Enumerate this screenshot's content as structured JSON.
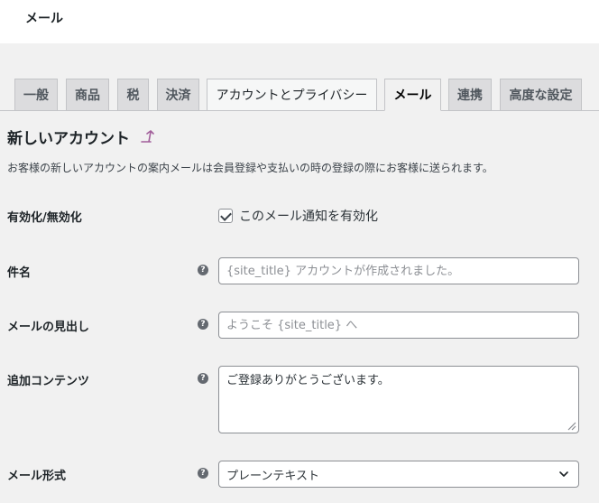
{
  "header": {
    "title": "メール"
  },
  "tabs": [
    {
      "label": "一般"
    },
    {
      "label": "商品"
    },
    {
      "label": "税"
    },
    {
      "label": "決済"
    },
    {
      "label": "アカウントとプライバシー"
    },
    {
      "label": "メール",
      "active": true
    },
    {
      "label": "連携"
    },
    {
      "label": "高度な設定"
    }
  ],
  "section": {
    "title": "新しいアカウント",
    "description": "お客様の新しいアカウントの案内メールは会員登録や支払いの時の登録の際にお客様に送られます。"
  },
  "form": {
    "enable": {
      "label": "有効化/無効化",
      "checkbox_label": "このメール通知を有効化",
      "checked": true
    },
    "subject": {
      "label": "件名",
      "placeholder": "{site_title} アカウントが作成されました。",
      "value": ""
    },
    "heading": {
      "label": "メールの見出し",
      "placeholder": "ようこそ {site_title} へ",
      "value": ""
    },
    "additional_content": {
      "label": "追加コンテンツ",
      "value": "ご登録ありがとうございます。"
    },
    "email_type": {
      "label": "メール形式",
      "selected": "プレーンテキスト"
    }
  },
  "icons": {
    "help": "question-circle-icon",
    "up": "up-arrow-icon",
    "select": "chevron-down-icon"
  },
  "colors": {
    "background": "#f1f1f1",
    "accent": "#2271b1",
    "link_icon": "#a15e9a"
  }
}
